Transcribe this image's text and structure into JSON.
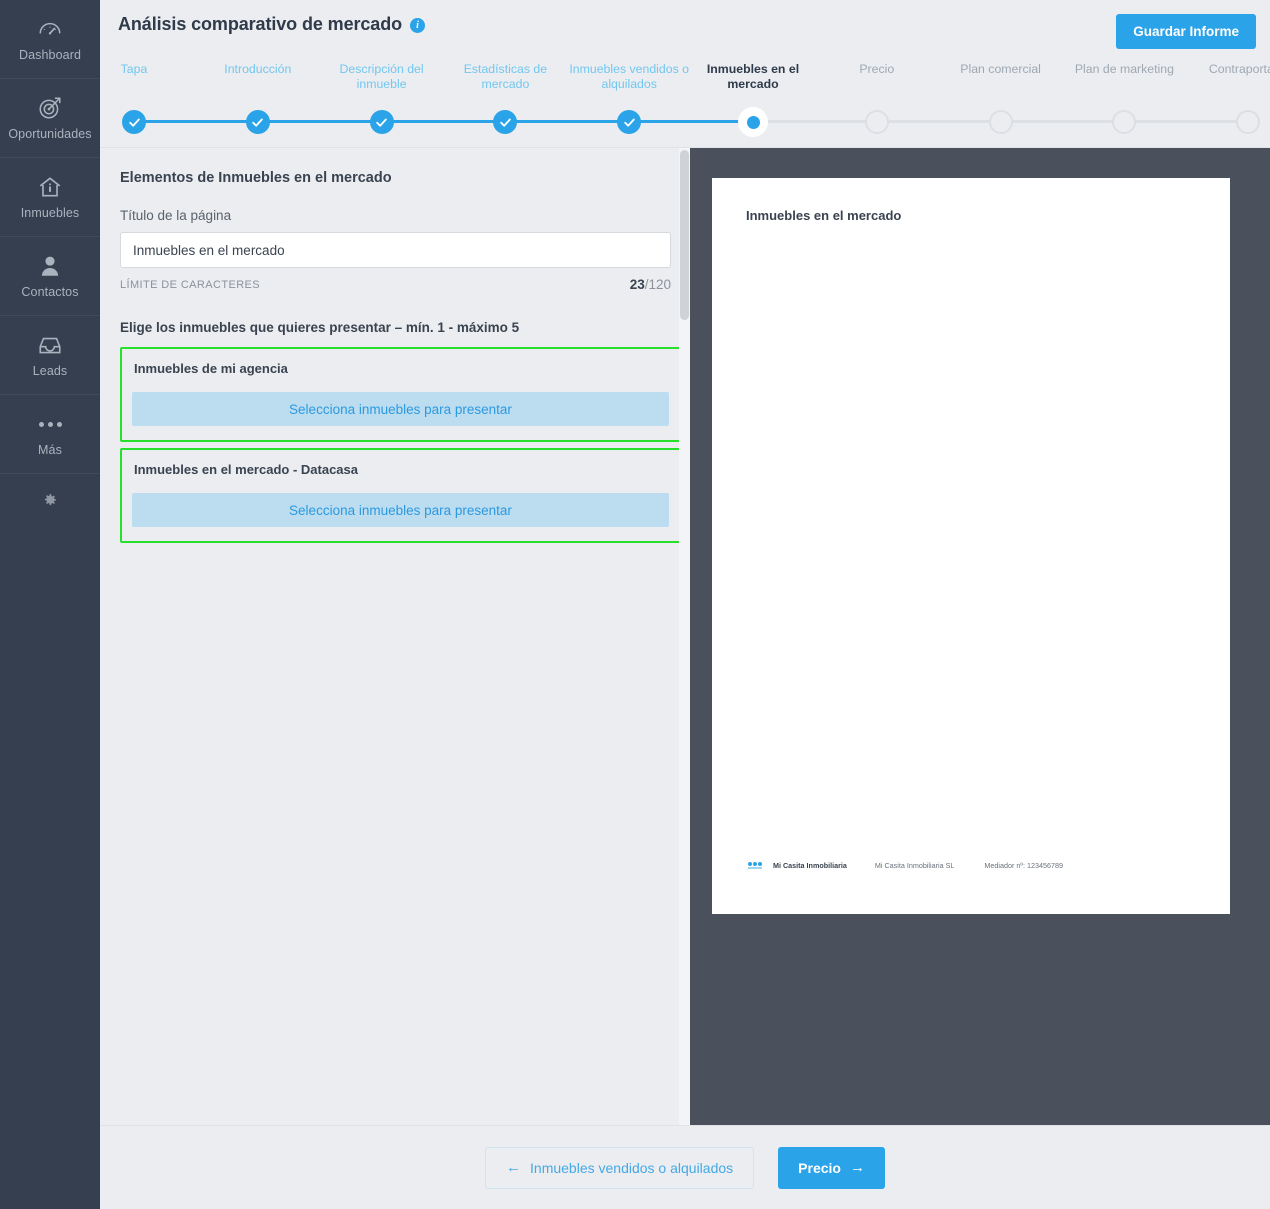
{
  "sidebar": {
    "items": [
      {
        "label": "Dashboard",
        "icon": "gauge-icon"
      },
      {
        "label": "Oportunidades",
        "icon": "target-icon"
      },
      {
        "label": "Inmuebles",
        "icon": "house-icon"
      },
      {
        "label": "Contactos",
        "icon": "person-icon"
      },
      {
        "label": "Leads",
        "icon": "inbox-icon"
      },
      {
        "label": "Más",
        "icon": "ellipsis-icon"
      }
    ],
    "settings_icon": "gear-icon"
  },
  "header": {
    "title": "Análisis comparativo de mercado",
    "info_icon": "info-icon",
    "save_label": "Guardar Informe"
  },
  "stepper": {
    "steps": [
      {
        "label": "Tapa",
        "state": "done"
      },
      {
        "label": "Introducción",
        "state": "done"
      },
      {
        "label": "Descripción del inmueble",
        "state": "done"
      },
      {
        "label": "Estadísticas de mercado",
        "state": "done"
      },
      {
        "label": "Inmuebles vendidos o alquilados",
        "state": "done"
      },
      {
        "label": "Inmuebles en el mercado",
        "state": "current"
      },
      {
        "label": "Precio",
        "state": "todo"
      },
      {
        "label": "Plan comercial",
        "state": "todo"
      },
      {
        "label": "Plan de marketing",
        "state": "todo"
      },
      {
        "label": "Contraportada",
        "state": "todo"
      }
    ],
    "active_index": 5
  },
  "form": {
    "section_title": "Elementos de Inmuebles en el mercado",
    "title_field_label": "Título de la página",
    "title_field_value": "Inmuebles en el mercado",
    "title_field_placeholder": "Título de la página",
    "char_limit_label": "LÍMITE DE CARACTERES",
    "char_used": "23",
    "char_max": "/120",
    "choose_label": "Elige los inmuebles que quieres presentar – mín. 1 - máximo 5",
    "cards": [
      {
        "title": "Inmuebles de mi agencia",
        "button": "Selecciona inmuebles para presentar"
      },
      {
        "title": "Inmuebles en el mercado - Datacasa",
        "button": "Selecciona inmuebles para presentar"
      }
    ]
  },
  "preview": {
    "doc_title": "Inmuebles en el mercado",
    "footer_brand": "Mi Casita Inmobiliaria",
    "footer_legal": "Mi Casita Inmobiliaria SL",
    "footer_license": "Mediador nº: 123456789"
  },
  "footer_nav": {
    "prev_label": "Inmuebles vendidos o alquilados",
    "next_label": "Precio",
    "prev_arrow": "←",
    "next_arrow": "→"
  },
  "colors": {
    "accent": "#2ba3e8",
    "sidebar_bg": "#353f4f",
    "page_bg": "#ebedf0",
    "preview_bg": "#4b515c",
    "highlight_border": "#26e02a",
    "select_btn_bg": "#bcdcf0"
  }
}
